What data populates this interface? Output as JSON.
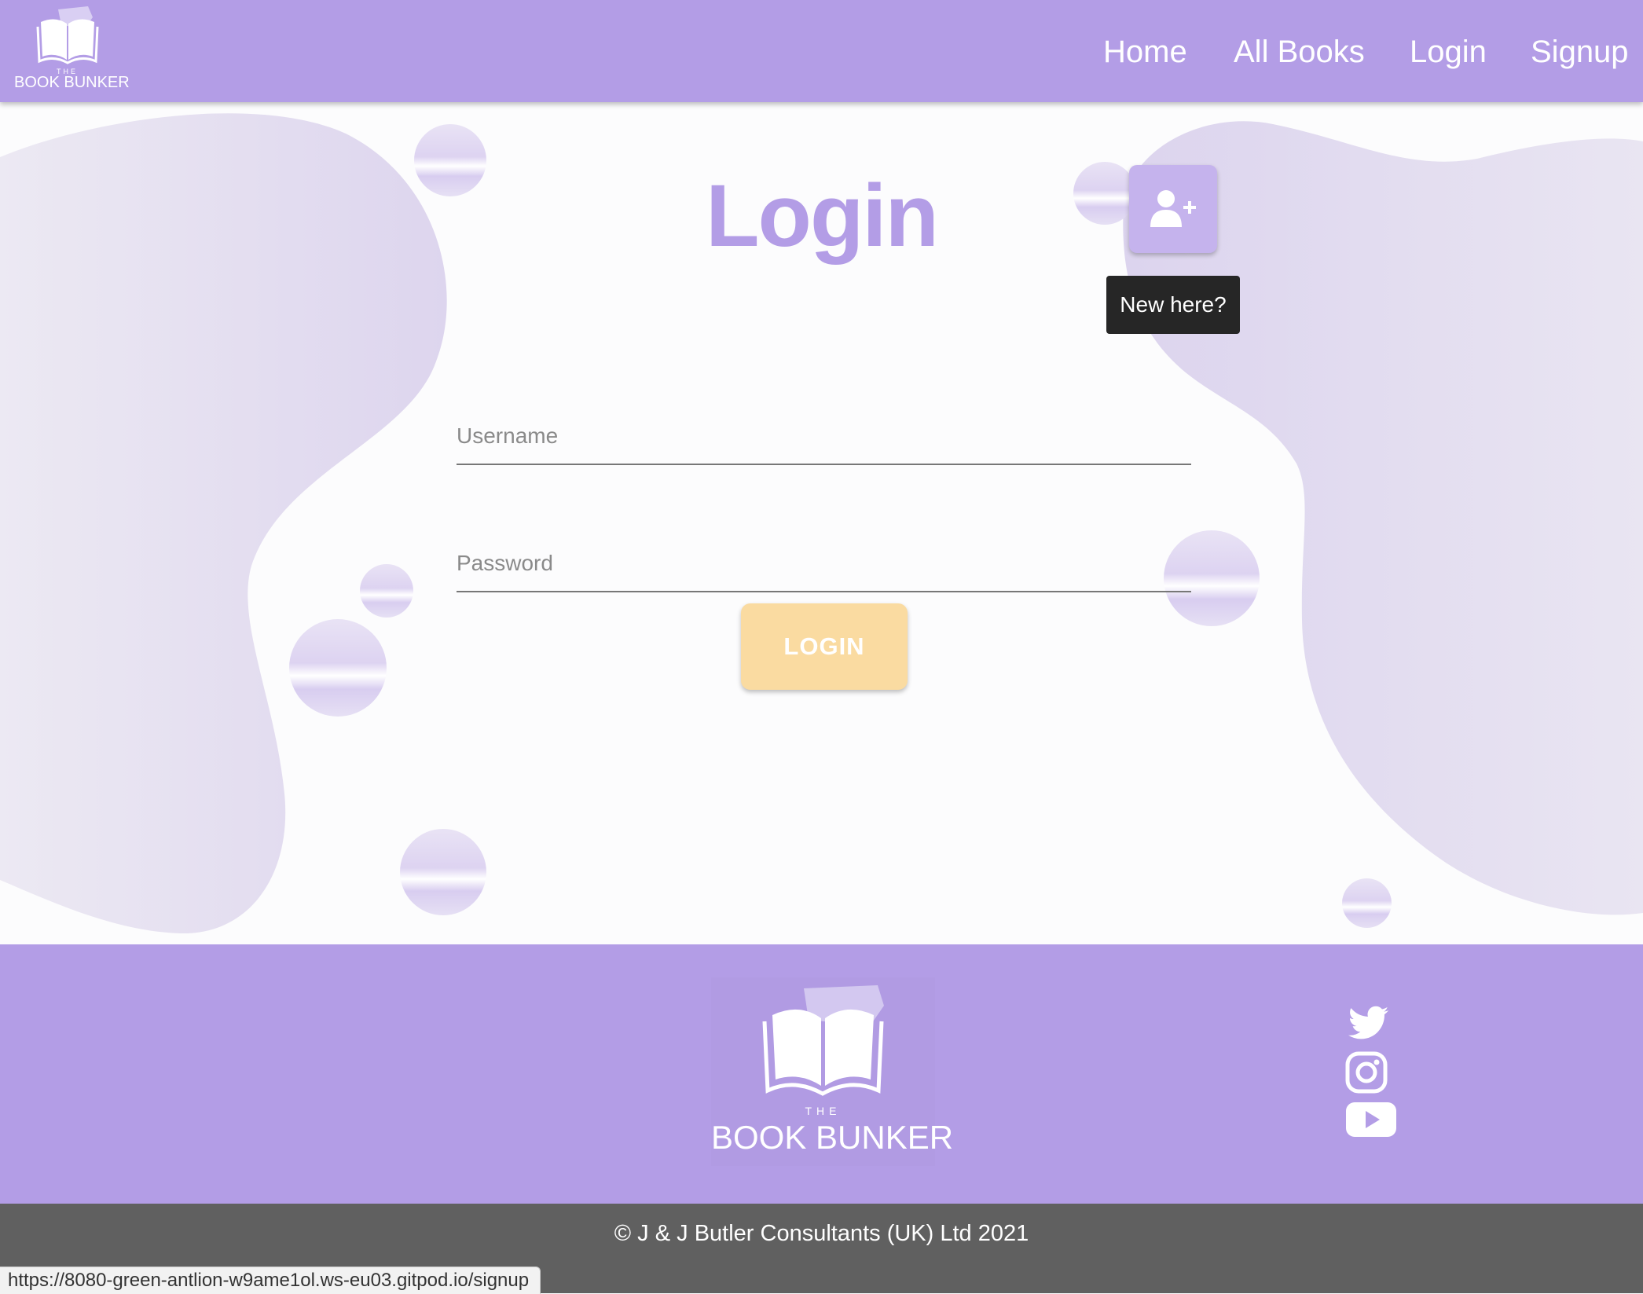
{
  "navbar": {
    "brand_the": "THE",
    "brand_name": "BOOK BUNKER",
    "links": {
      "home": "Home",
      "all_books": "All Books",
      "login": "Login",
      "signup": "Signup"
    }
  },
  "main": {
    "title": "Login",
    "signup_icon": "user-plus-icon",
    "tooltip": "New here?",
    "username": {
      "placeholder": "Username",
      "value": ""
    },
    "password": {
      "placeholder": "Password",
      "value": ""
    },
    "login_button": "LOGIN"
  },
  "footer": {
    "logo_the": "THE",
    "logo_name": "BOOK BUNKER",
    "social_icons": [
      "twitter-icon",
      "instagram-icon",
      "youtube-icon"
    ]
  },
  "copyright": "© J & J Butler Consultants (UK) Ltd 2021",
  "status_bar_url": "https://8080-green-antlion-w9ame1ol.ws-eu03.gitpod.io/signup",
  "colors": {
    "brand_purple": "#b39de6",
    "login_button": "#fadba1",
    "copyright_bar": "#606060",
    "tooltip_bg": "#262626"
  }
}
